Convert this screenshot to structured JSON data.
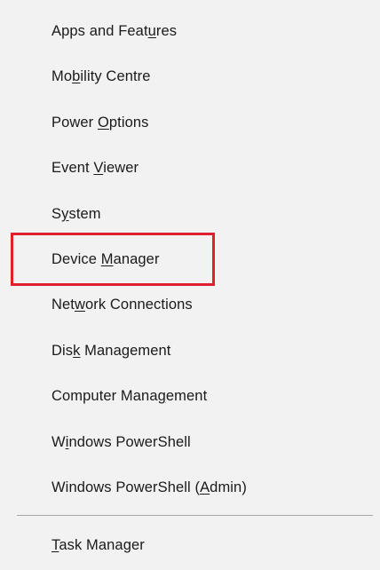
{
  "menu": {
    "items": [
      {
        "pre": "Apps and Feat",
        "acc": "u",
        "post": "res"
      },
      {
        "pre": "Mo",
        "acc": "b",
        "post": "ility Centre"
      },
      {
        "pre": "Power ",
        "acc": "O",
        "post": "ptions"
      },
      {
        "pre": "Event ",
        "acc": "V",
        "post": "iewer"
      },
      {
        "pre": "S",
        "acc": "y",
        "post": "stem"
      },
      {
        "pre": "Device ",
        "acc": "M",
        "post": "anager"
      },
      {
        "pre": "Net",
        "acc": "w",
        "post": "ork Connections"
      },
      {
        "pre": "Dis",
        "acc": "k",
        "post": " Management"
      },
      {
        "pre": "Computer Mana",
        "acc": "g",
        "post": "ement"
      },
      {
        "pre": "W",
        "acc": "i",
        "post": "ndows PowerShell"
      },
      {
        "pre": "Windows PowerShell (",
        "acc": "A",
        "post": "dmin)"
      },
      {
        "pre": "",
        "acc": "T",
        "post": "ask Manager"
      }
    ]
  },
  "highlight_color": "#e0202e"
}
